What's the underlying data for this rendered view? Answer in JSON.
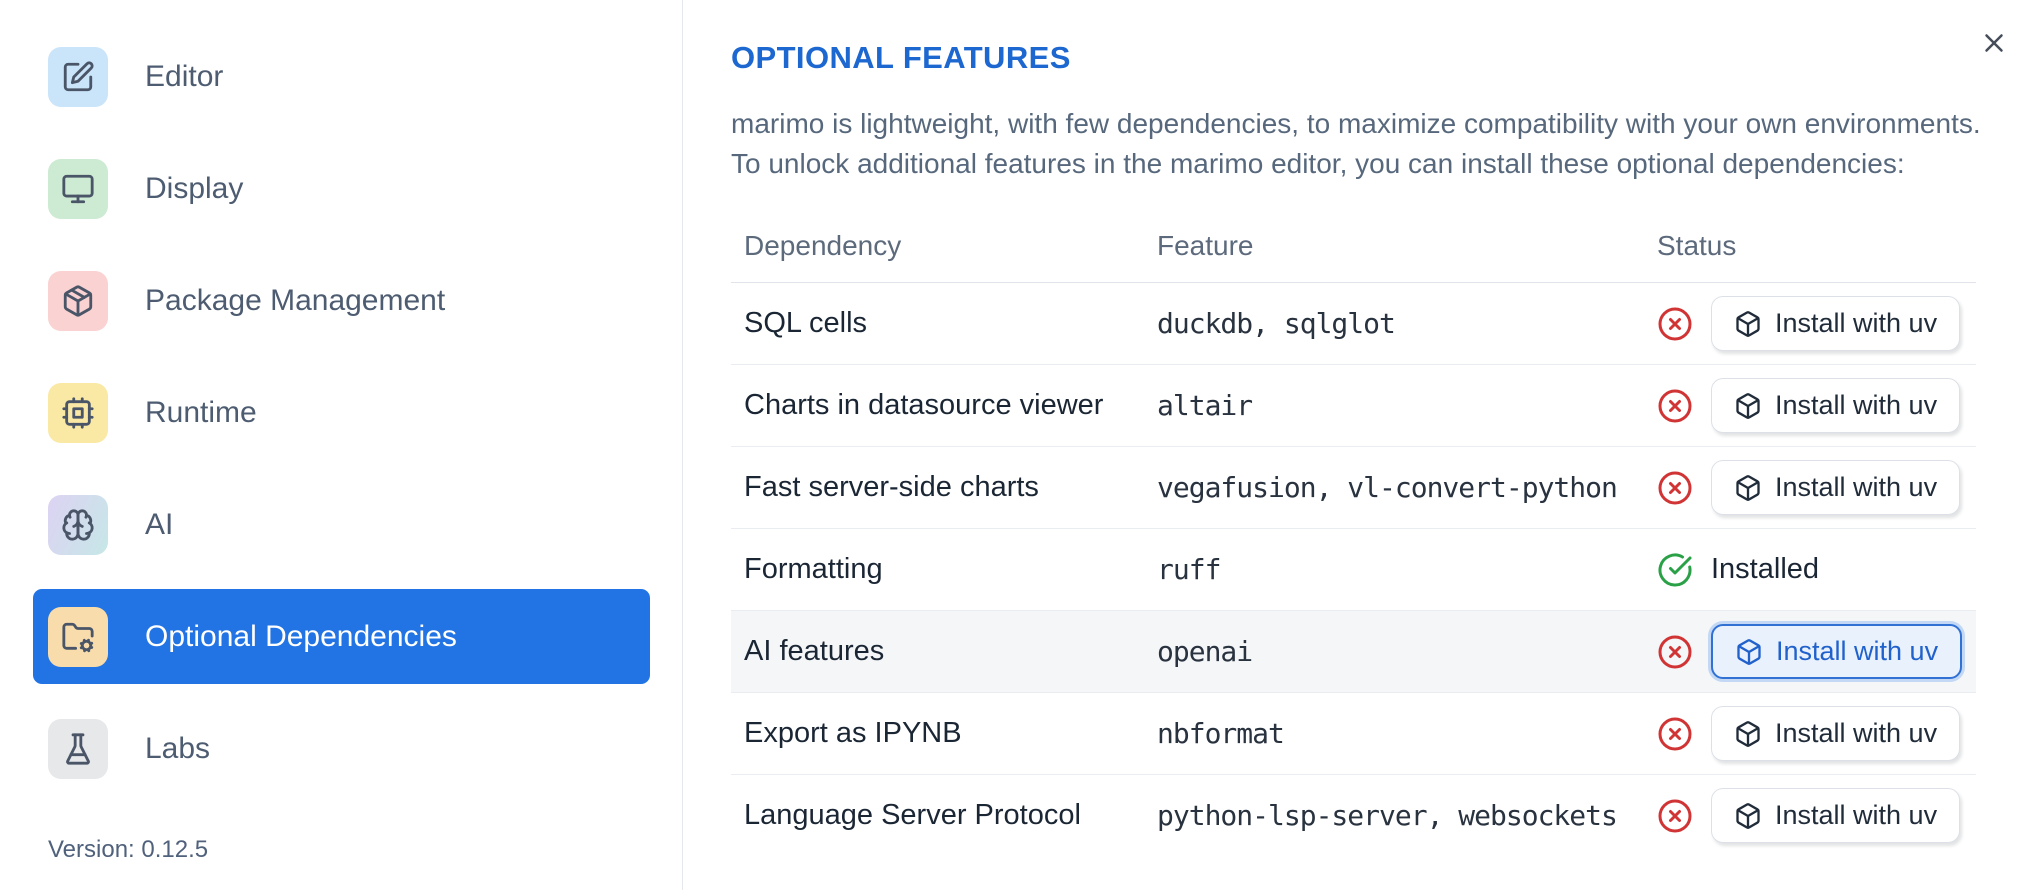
{
  "sidebar": {
    "items": [
      {
        "label": "Editor",
        "icon": "square-pen-icon",
        "tile": "#cae4fa",
        "active": false
      },
      {
        "label": "Display",
        "icon": "monitor-icon",
        "tile": "#cdead2",
        "active": false
      },
      {
        "label": "Package Management",
        "icon": "package-icon",
        "tile": "#fad2d2",
        "active": false
      },
      {
        "label": "Runtime",
        "icon": "cpu-icon",
        "tile": "#fae9a4",
        "active": false
      },
      {
        "label": "AI",
        "icon": "brain-icon",
        "tile": "#ddd3f3",
        "tile2": "#c6e7e7",
        "active": false
      },
      {
        "label": "Optional Dependencies",
        "icon": "folder-cog-icon",
        "tile": "#f8dcab",
        "active": true
      },
      {
        "label": "Labs",
        "icon": "flask-icon",
        "tile": "#e7e8ea",
        "active": false
      }
    ],
    "version": "Version: 0.12.5"
  },
  "main": {
    "title": "OPTIONAL FEATURES",
    "description_lines": [
      "marimo is lightweight, with few dependencies, to maximize compatibility with your own environments.",
      "To unlock additional features in the marimo editor, you can install these optional dependencies:"
    ],
    "table": {
      "headers": [
        "Dependency",
        "Feature",
        "Status"
      ],
      "rows": [
        {
          "dependency": "SQL cells",
          "feature": "duckdb, sqlglot",
          "installed": false,
          "action": "Install with uv",
          "highlighted": false
        },
        {
          "dependency": "Charts in datasource viewer",
          "feature": "altair",
          "installed": false,
          "action": "Install with uv",
          "highlighted": false
        },
        {
          "dependency": "Fast server-side charts",
          "feature": "vegafusion, vl-convert-python",
          "installed": false,
          "action": "Install with uv",
          "highlighted": false
        },
        {
          "dependency": "Formatting",
          "feature": "ruff",
          "installed": true,
          "status_label": "Installed",
          "highlighted": false
        },
        {
          "dependency": "AI features",
          "feature": "openai",
          "installed": false,
          "action": "Install with uv",
          "highlighted": true
        },
        {
          "dependency": "Export as IPYNB",
          "feature": "nbformat",
          "installed": false,
          "action": "Install with uv",
          "highlighted": false
        },
        {
          "dependency": "Language Server Protocol",
          "feature": "python-lsp-server, websockets",
          "installed": false,
          "action": "Install with uv",
          "highlighted": false
        }
      ]
    }
  },
  "colors": {
    "active_item_blue": "#2274e4",
    "title_blue": "#1d67d0",
    "error_red": "#d03434",
    "success_green": "#2aa147",
    "highlight_button_blue": "#2161cb",
    "row_highlight": "#f5f6f8"
  }
}
